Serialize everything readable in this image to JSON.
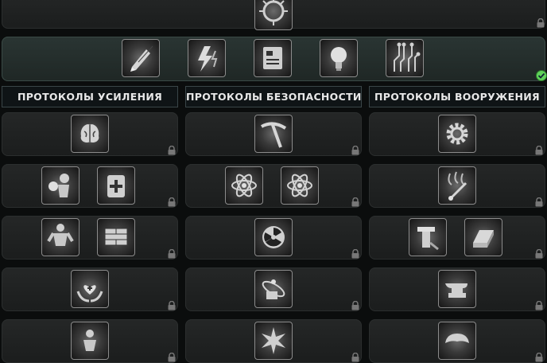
{
  "columns": [
    {
      "title": "ПРОТОКОЛЫ УСИЛЕНИЯ"
    },
    {
      "title": "ПРОТОКОЛЫ БЕЗОПАСНОСТИ"
    },
    {
      "title": "ПРОТОКОЛЫ ВООРУЖЕНИЯ"
    }
  ],
  "top_panel": {
    "status": "locked",
    "icon": "virus-icon"
  },
  "active_panel": {
    "status": "completed",
    "icons": [
      "pencil-icon",
      "lightning-icon",
      "book-icon",
      "bulb-icon",
      "circuit-icon"
    ]
  },
  "grid": [
    [
      {
        "icons": [
          "brain-icon"
        ],
        "locked": true
      },
      {
        "icons": [
          "pickaxe-icon"
        ],
        "locked": true
      },
      {
        "icons": [
          "gear-icon"
        ],
        "locked": true
      }
    ],
    [
      {
        "icons": [
          "punch-icon",
          "medkit-icon"
        ],
        "locked": true
      },
      {
        "icons": [
          "atom-icon",
          "atom-icon"
        ],
        "locked": true
      },
      {
        "icons": [
          "dropper-icon"
        ],
        "locked": true
      }
    ],
    [
      {
        "icons": [
          "muscle-icon",
          "wall-icon"
        ],
        "locked": true
      },
      {
        "icons": [
          "radiation-icon"
        ],
        "locked": true
      },
      {
        "icons": [
          "hammer-icon",
          "ingot-icon"
        ],
        "locked": true
      }
    ],
    [
      {
        "icons": [
          "heart-hands-icon"
        ],
        "locked": true
      },
      {
        "icons": [
          "atom-cards-icon"
        ],
        "locked": true
      },
      {
        "icons": [
          "anvil-icon"
        ],
        "locked": true
      }
    ],
    [
      {
        "icons": [
          "figure-icon"
        ],
        "locked": true
      },
      {
        "icons": [
          "burst-icon"
        ],
        "locked": true
      },
      {
        "icons": [
          "explosion-icon"
        ],
        "locked": true
      }
    ]
  ],
  "colors": {
    "accent_check": "#5fd25a",
    "panel": "#222424",
    "header_border": "#3a4548"
  }
}
